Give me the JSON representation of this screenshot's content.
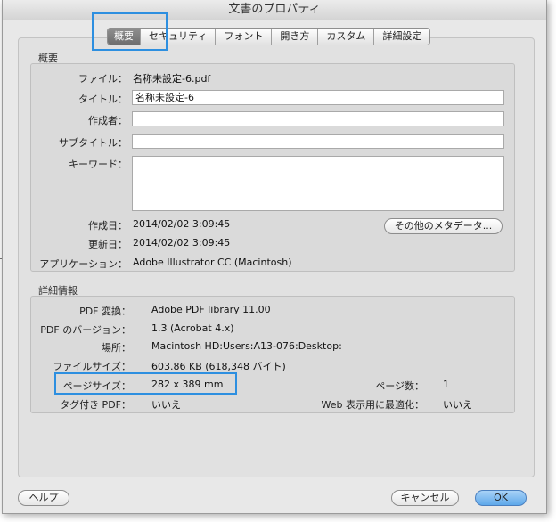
{
  "window": {
    "title": "文書のプロパティ"
  },
  "tabs": [
    "概要",
    "セキュリティ",
    "フォント",
    "開き方",
    "カスタム",
    "詳細設定"
  ],
  "overview": {
    "group_label": "概要",
    "file_label": "ファイル：",
    "file_value": "名称未設定-6.pdf",
    "title_label": "タイトル：",
    "title_value": "名称未設定-6",
    "author_label": "作成者：",
    "author_value": "",
    "subject_label": "サブタイトル：",
    "subject_value": "",
    "keywords_label": "キーワード：",
    "keywords_value": "",
    "created_label": "作成日：",
    "created_value": "2014/02/02 3:09:45",
    "modified_label": "更新日：",
    "modified_value": "2014/02/02 3:09:45",
    "app_label": "アプリケーション：",
    "app_value": "Adobe Illustrator CC (Macintosh)",
    "metadata_button": "その他のメタデータ..."
  },
  "details": {
    "group_label": "詳細情報",
    "producer_label": "PDF 変換：",
    "producer_value": "Adobe PDF library 11.00",
    "version_label": "PDF のバージョン：",
    "version_value": "1.3 (Acrobat 4.x)",
    "location_label": "場所：",
    "location_value": "Macintosh HD:Users:A13-076:Desktop:",
    "filesize_label": "ファイルサイズ：",
    "filesize_value": "603.86 KB (618,348 バイト)",
    "pagesize_label": "ページサイズ：",
    "pagesize_value": "282 x 389 mm",
    "pagecount_label": "ページ数：",
    "pagecount_value": "1",
    "tagged_label": "タグ付き PDF：",
    "tagged_value": "いいえ",
    "fastweb_label": "Web 表示用に最適化：",
    "fastweb_value": "いいえ"
  },
  "footer": {
    "help": "ヘルプ",
    "cancel": "キャンセル",
    "ok": "OK"
  },
  "colors": {
    "highlight": "#2d8fe0",
    "ok_button": "#5ea8ea"
  }
}
